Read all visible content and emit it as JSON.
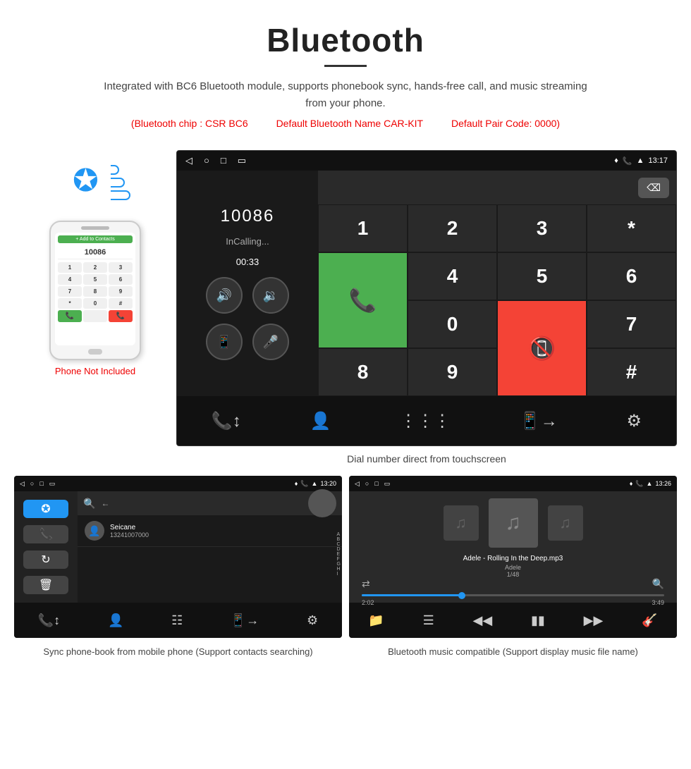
{
  "header": {
    "title": "Bluetooth",
    "description": "Integrated with BC6 Bluetooth module, supports phonebook sync, hands-free call, and music streaming from your phone.",
    "spec1": "(Bluetooth chip : CSR BC6",
    "spec2": "Default Bluetooth Name CAR-KIT",
    "spec3": "Default Pair Code: 0000)"
  },
  "phone_label": "Phone Not Included",
  "dial_screen": {
    "status_time": "13:17",
    "caller_number": "10086",
    "call_status": "InCalling...",
    "call_time": "00:33",
    "caption": "Dial number direct from touchscreen"
  },
  "phonebook_screen": {
    "status_time": "13:20",
    "contact_name": "Seicane",
    "contact_number": "13241007000",
    "caption": "Sync phone-book from mobile phone\n(Support contacts searching)"
  },
  "music_screen": {
    "status_time": "13:26",
    "song_title": "Adele - Rolling In the Deep.mp3",
    "artist": "Adele",
    "track_count": "1/48",
    "time_current": "2:02",
    "time_total": "3:49",
    "caption": "Bluetooth music compatible\n(Support display music file name)"
  },
  "keypad": {
    "keys": [
      "1",
      "2",
      "3",
      "*",
      "4",
      "5",
      "6",
      "0",
      "7",
      "8",
      "9",
      "#"
    ]
  },
  "alpha_list": [
    "A",
    "B",
    "C",
    "D",
    "E",
    "F",
    "G",
    "H",
    "I"
  ],
  "bottom_icons_dial": [
    "↕️",
    "👤",
    "⊞",
    "📋",
    "⚙️"
  ],
  "bottom_icons_pb": [
    "↕️",
    "👤",
    "⊞",
    "📋",
    "⚙️"
  ],
  "bottom_icons_music": [
    "📁",
    "≡",
    "⏮",
    "⏸",
    "⏭",
    "🎛️"
  ]
}
